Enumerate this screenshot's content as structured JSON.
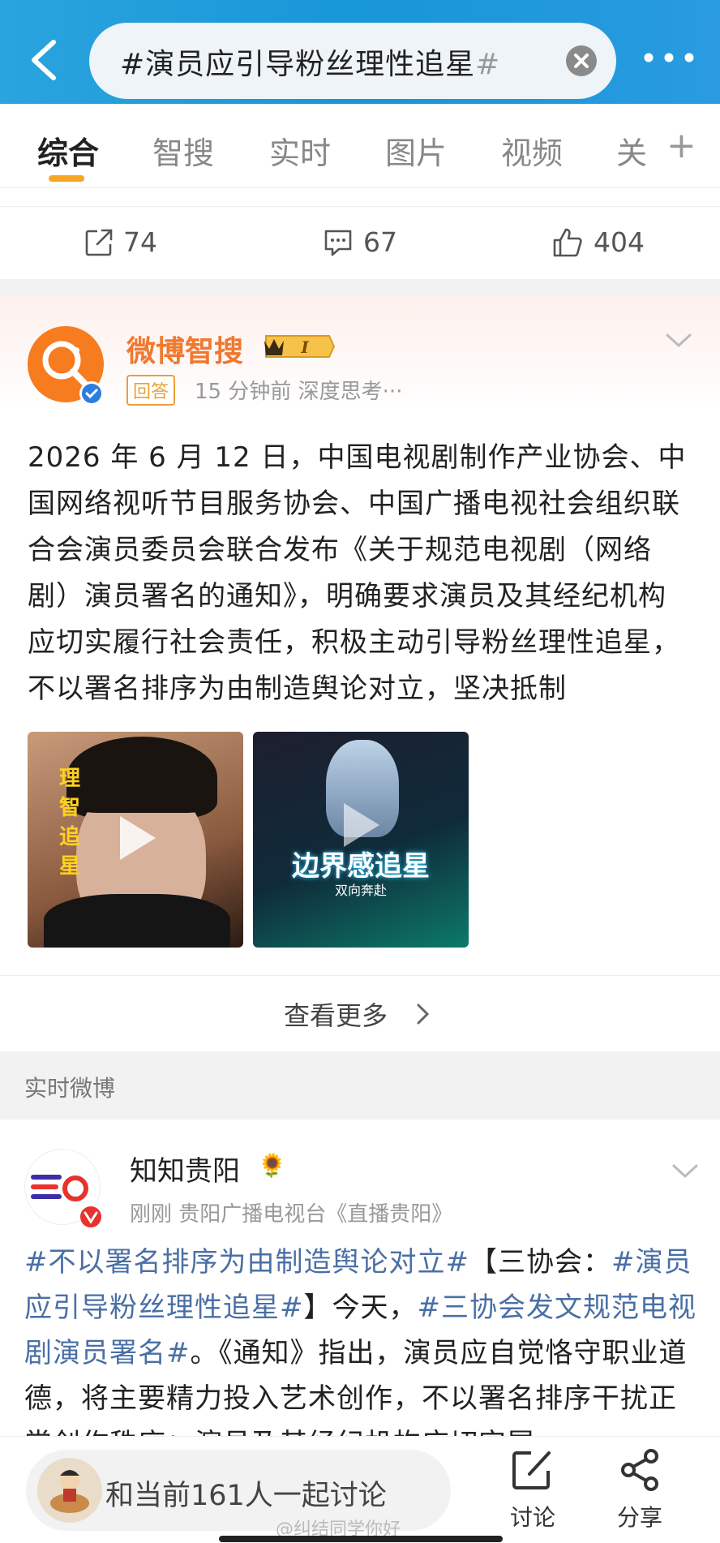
{
  "header": {
    "search_text": "#演员应引导粉丝理性追星",
    "search_hash_end": "#"
  },
  "tabs": [
    "综合",
    "智搜",
    "实时",
    "图片",
    "视频",
    "关"
  ],
  "actions": {
    "repost": "74",
    "comment": "67",
    "like": "404"
  },
  "smart_card": {
    "name": "微博智搜",
    "badge_level": "I",
    "tag": "回答",
    "meta": "15 分钟前  深度思考···",
    "body": "2026 年 6 月 12 日，中国电视剧制作产业协会、中国网络视听节目服务协会、中国广播电视社会组织联合会演员委员会联合发布《关于规范电视剧（网络剧）演员署名的通知》，明确要求演员及其经纪机构应切实履行社会责任，积极主动引导粉丝理性追星，不以署名排序为由制造舆论对立，坚决抵制",
    "thumb1_text": "理智追星",
    "thumb2_title": "边界感追星",
    "thumb2_sub": "双向奔赴",
    "see_more": "查看更多"
  },
  "section_title": "实时微博",
  "post": {
    "name": "知知贵阳",
    "flower": "🌻",
    "meta": "刚刚   贵阳广播电视台《直播贵阳》",
    "topic1": "#不以署名排序为由制造舆论对立#",
    "text1": "【三协会：",
    "topic2": "#演员应引导粉丝理性追星#",
    "text2": "】今天，",
    "topic3": "#三协会发文规范电视剧演员署名#",
    "text3": "。《通知》指出，演员应自觉恪守职业道德，将主要精力投入艺术创作，不以署名排序干扰正常创作秩序；演员及其经纪机构应切实履"
  },
  "bottom": {
    "discuss_text": "和当前161人一起讨论",
    "discuss_label": "讨论",
    "share_label": "分享",
    "watermark": "@纠结同学你好"
  },
  "colors": {
    "header_blue": "#1796d8",
    "accent_orange": "#f6a623",
    "topic_blue": "#4a6fa5",
    "smart_orange": "#f07830"
  }
}
